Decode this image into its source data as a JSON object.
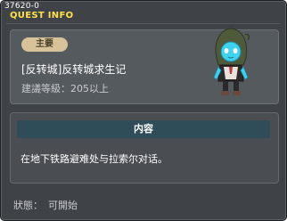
{
  "window": {
    "id_label": "37620-0",
    "title": "QUEST INFO"
  },
  "quest": {
    "badge": "主要",
    "name": "[反转城]反转城求生记",
    "level_req": "建議等級：205以上",
    "npc_icon": "hooded-npc-portrait"
  },
  "content": {
    "header": "内容",
    "text": "在地下铁路避难处与拉索尔对话。"
  },
  "status": {
    "label": "狀態：",
    "value": "可開始"
  }
}
